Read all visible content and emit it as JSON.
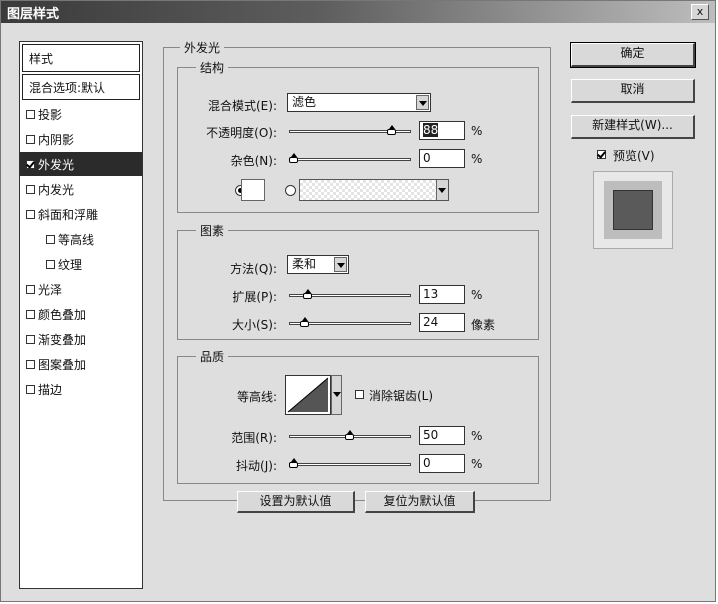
{
  "window": {
    "title": "图层样式",
    "close_label": "x"
  },
  "style_list": {
    "header": "样式",
    "blend_options": "混合选项:默认",
    "items": [
      {
        "label": "投影",
        "checked": false,
        "sub": false,
        "selected": false
      },
      {
        "label": "内阴影",
        "checked": false,
        "sub": false,
        "selected": false
      },
      {
        "label": "外发光",
        "checked": true,
        "sub": false,
        "selected": true
      },
      {
        "label": "内发光",
        "checked": false,
        "sub": false,
        "selected": false
      },
      {
        "label": "斜面和浮雕",
        "checked": false,
        "sub": false,
        "selected": false
      },
      {
        "label": "等高线",
        "checked": false,
        "sub": true,
        "selected": false
      },
      {
        "label": "纹理",
        "checked": false,
        "sub": true,
        "selected": false
      },
      {
        "label": "光泽",
        "checked": false,
        "sub": false,
        "selected": false
      },
      {
        "label": "颜色叠加",
        "checked": false,
        "sub": false,
        "selected": false
      },
      {
        "label": "渐变叠加",
        "checked": false,
        "sub": false,
        "selected": false
      },
      {
        "label": "图案叠加",
        "checked": false,
        "sub": false,
        "selected": false
      },
      {
        "label": "描边",
        "checked": false,
        "sub": false,
        "selected": false
      }
    ]
  },
  "outer_glow": {
    "title": "外发光",
    "structure": {
      "title": "结构",
      "blend_mode_label": "混合模式(E):",
      "blend_mode_value": "滤色",
      "opacity_label": "不透明度(O):",
      "opacity_value": "88",
      "opacity_unit": "%",
      "opacity_level": 0.88,
      "noise_label": "杂色(N):",
      "noise_value": "0",
      "noise_unit": "%",
      "noise_level": 0.0
    },
    "elements": {
      "title": "图素",
      "technique_label": "方法(Q):",
      "technique_value": "柔和",
      "spread_label": "扩展(P):",
      "spread_value": "13",
      "spread_unit": "%",
      "spread_level": 0.13,
      "size_label": "大小(S):",
      "size_value": "24",
      "size_unit": "像素",
      "size_level": 0.097
    },
    "quality": {
      "title": "品质",
      "contour_label": "等高线:",
      "antialias_label": "消除锯齿(L)",
      "range_label": "范围(R):",
      "range_value": "50",
      "range_unit": "%",
      "range_level": 0.5,
      "jitter_label": "抖动(J):",
      "jitter_value": "0",
      "jitter_unit": "%",
      "jitter_level": 0.0
    },
    "set_default_label": "设置为默认值",
    "reset_default_label": "复位为默认值"
  },
  "actions": {
    "ok_label": "确定",
    "cancel_label": "取消",
    "new_style_label": "新建样式(W)...",
    "preview_label": "预览(V)",
    "preview_checked": true
  },
  "colors": {
    "preview_swatch": "#5a5a5a"
  }
}
